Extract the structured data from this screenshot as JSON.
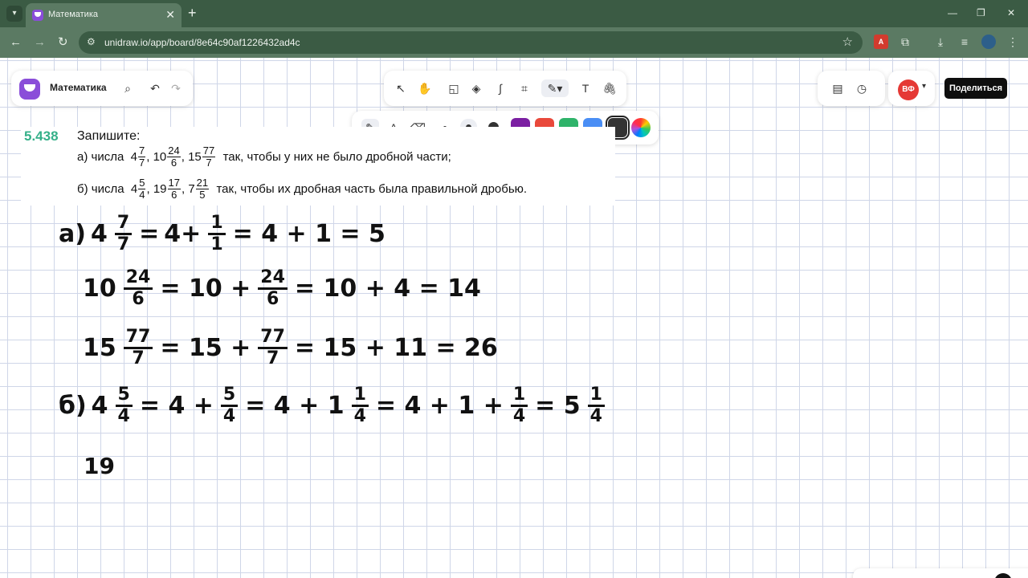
{
  "browser": {
    "tab_title": "Математика",
    "url": "unidraw.io/app/board/8e64c90af1226432ad4c",
    "tab_close": "✕",
    "new_tab": "+",
    "minimize": "—",
    "restore": "❐",
    "close": "✕",
    "pdf_ext_label": "A"
  },
  "board": {
    "title": "Математика",
    "avatar_initials": "ВФ",
    "share_label": "Поделиться"
  },
  "colors": {
    "swatches": [
      "#7b1fa2",
      "#e9493b",
      "#2fb36a",
      "#4a8ef5",
      "#333333"
    ],
    "accent": "#8a4dd9",
    "problem_number": "#35b089"
  },
  "problem": {
    "number": "5.438",
    "heading": "Запишите:",
    "line_a": {
      "prefix": "а) числа",
      "items": [
        {
          "whole": "4",
          "num": "7",
          "den": "7"
        },
        {
          "whole": "10",
          "num": "24",
          "den": "6"
        },
        {
          "whole": "15",
          "num": "77",
          "den": "7"
        }
      ],
      "suffix": "так, чтобы у них не было дробной части;"
    },
    "line_b": {
      "prefix": "б) числа",
      "items": [
        {
          "whole": "4",
          "num": "5",
          "den": "4"
        },
        {
          "whole": "19",
          "num": "17",
          "den": "6"
        },
        {
          "whole": "7",
          "num": "21",
          "den": "5"
        }
      ],
      "suffix": "так, чтобы их дробная часть была правильной дробью."
    },
    "comma": ","
  },
  "handwriting": {
    "row1": {
      "label": "а)",
      "whole": "4",
      "f1n": "7",
      "f1d": "7",
      "eq1": "=",
      "w2": "4+",
      "f2n": "1",
      "f2d": "1",
      "rest": "= 4 + 1 = 5"
    },
    "row2": {
      "whole": "10",
      "f1n": "24",
      "f1d": "6",
      "mid": "= 10 +",
      "f2n": "24",
      "f2d": "6",
      "rest": "= 10 + 4 = 14"
    },
    "row3": {
      "whole": "15",
      "f1n": "77",
      "f1d": "7",
      "mid": "= 15 +",
      "f2n": "77",
      "f2d": "7",
      "rest": "= 15 + 11 = 26"
    },
    "row4": {
      "label": "б)",
      "whole": "4",
      "f1n": "5",
      "f1d": "4",
      "p1": "= 4 +",
      "f2n": "5",
      "f2d": "4",
      "p2": "= 4 + 1",
      "f3n": "1",
      "f3d": "4",
      "p3": "= 4 + 1 +",
      "f4n": "1",
      "f4d": "4",
      "p4": "= 5",
      "f5n": "1",
      "f5d": "4"
    },
    "row5": {
      "text": "19"
    }
  }
}
